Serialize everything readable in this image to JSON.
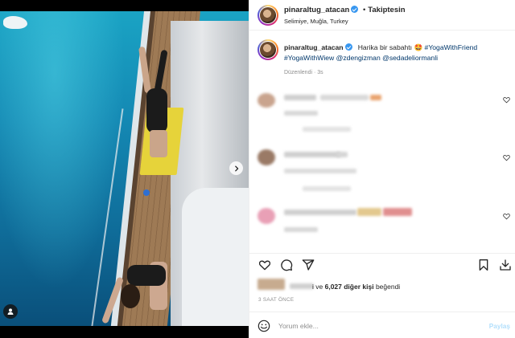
{
  "post": {
    "username": "pinaraltug_atacan",
    "follow_status": "Takiptesin",
    "separator": "•",
    "location": "Selimiye, Muğla, Turkey"
  },
  "caption": {
    "username": "pinaraltug_atacan",
    "text": "Harika bir sabahtı 🤩",
    "tags": [
      "#YogaWithFriend",
      "#YogaWithWiew",
      "@zdengizman",
      "@sedadeliormanli"
    ],
    "edited": "Düzenlendi · 3s"
  },
  "icons": {
    "next": "chevron-right-icon",
    "tag": "user-tag-icon",
    "verified": "verified-badge-icon",
    "like": "heart-icon",
    "comment": "comment-icon",
    "share": "paper-plane-icon",
    "save": "bookmark-icon",
    "emoji": "emoji-icon"
  },
  "likes": {
    "prefix": "i ve",
    "count": "6,027 diğer kişi",
    "suffix": "beğendi"
  },
  "timestamp": "3 SAAT ÖNCE",
  "comment_box": {
    "placeholder": "Yorum ekle...",
    "post_label": "Paylaş"
  },
  "colors": {
    "link": "#00376b",
    "verified": "#3897f0",
    "post_disabled": "#b2dffc",
    "muted": "#8e8e8e"
  }
}
